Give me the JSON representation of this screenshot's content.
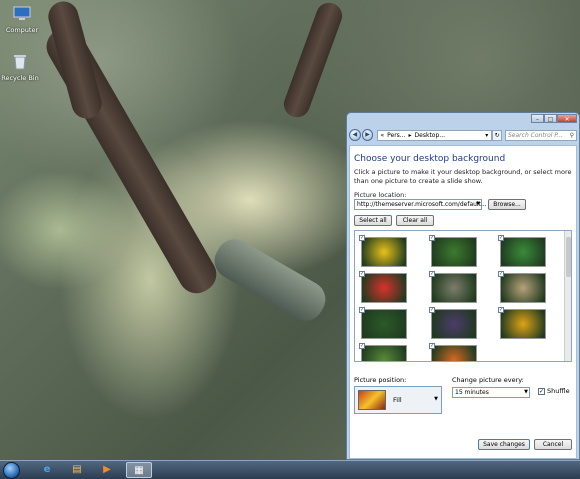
{
  "desktop": {
    "icons": [
      {
        "label": "Computer",
        "icon": "computer-icon"
      },
      {
        "label": "Recycle Bin",
        "icon": "recycle-bin-icon"
      }
    ]
  },
  "window": {
    "buttons": {
      "minimize": "–",
      "maximize": "□",
      "close": "✕"
    },
    "nav": {
      "back": "◀",
      "forward": "▶",
      "breadcrumb": [
        "«",
        "Pers...",
        "▸",
        "Desktop...",
        "▾"
      ],
      "refresh": "↻",
      "search_placeholder": "Search Control P...",
      "search_icon": "search-icon"
    },
    "heading": "Choose your desktop background",
    "description": "Click a picture to make it your desktop background, or select more than one picture to create a slide show.",
    "picture_location": {
      "label": "Picture location:",
      "value": "http://themeserver.microsoft.com/default...",
      "browse": "Browse..."
    },
    "select_all": "Select all",
    "clear_all": "Clear all",
    "gallery": [
      {
        "name": "yellow-flower",
        "color": "#e8c21a",
        "checked": true
      },
      {
        "name": "green-leaves",
        "color": "#3d7a2e",
        "checked": true
      },
      {
        "name": "red-flower-green",
        "color": "#3a8a3a",
        "checked": true
      },
      {
        "name": "red-dahlia",
        "color": "#d8322a",
        "checked": true
      },
      {
        "name": "lichen-grey",
        "color": "#7d7d6a",
        "checked": true
      },
      {
        "name": "dry-grass",
        "color": "#b7a27a",
        "checked": true
      },
      {
        "name": "white-flower",
        "color": "#2d5a2a",
        "checked": true
      },
      {
        "name": "pansies",
        "color": "#4c3b6a",
        "checked": true
      },
      {
        "name": "sunflower",
        "color": "#e0a218",
        "checked": true
      },
      {
        "name": "meadow",
        "color": "#5a8a3a",
        "checked": true
      },
      {
        "name": "orange-blossom",
        "color": "#d46a22",
        "checked": true
      }
    ],
    "picture_position": {
      "label": "Picture position:",
      "value": "Fill"
    },
    "change_picture": {
      "label": "Change picture every:",
      "value": "15 minutes"
    },
    "shuffle": {
      "label": "Shuffle",
      "checked": true
    },
    "save": "Save changes",
    "cancel": "Cancel"
  },
  "taskbar": {
    "items": [
      {
        "icon": "ie-icon",
        "glyph": "e"
      },
      {
        "icon": "explorer-icon",
        "glyph": "▤"
      },
      {
        "icon": "media-player-icon",
        "glyph": "▶"
      },
      {
        "icon": "control-panel-icon",
        "glyph": "▦"
      }
    ]
  }
}
